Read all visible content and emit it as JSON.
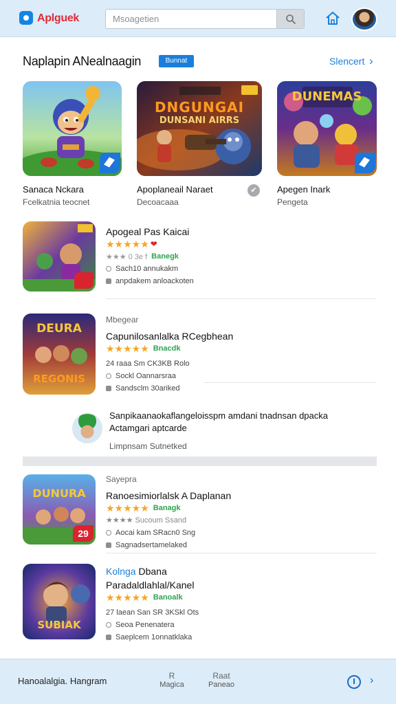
{
  "header": {
    "brand": "Aplguek",
    "search_placeholder": "Msoagetien"
  },
  "featured": {
    "title": "Naplapin ANealnaagin",
    "badge": "Bunnat",
    "see_all": "Slencert",
    "cards": [
      {
        "name": "Sanaca Nckara",
        "sub": "Fcelkatnia teocnet",
        "thumb_text": ""
      },
      {
        "name": "Apoplaneail Naraet",
        "sub": "Decoacaaa",
        "thumb_text": "DNGUNGAI",
        "thumb_text2": "DUNSANI AIRRS"
      },
      {
        "name": "Apegen Inark",
        "sub": "Pengeta",
        "thumb_text": "DUNEMAS"
      }
    ]
  },
  "list": [
    {
      "kicker": "",
      "title": "Apogeal Pas Kaicai",
      "stars": "★★★★★",
      "rating_line": "★★★ 0 3e f  Banegk",
      "line1": "Sach10 annukakm",
      "line2": "anpdakem anloackoten",
      "pill": ""
    },
    {
      "kicker": "Mbegear",
      "title": "Capunilosanlalka RCegbhean",
      "stars": "★★★★★",
      "pill": "Bnacdk",
      "meta": "24 raaa Sm CK3KB Rolo",
      "line1": "Sockl Oannarsraa",
      "line2": "Sandsclm 30ariked",
      "thumb_text": "DEURA",
      "thumb_text2": "REGONIS"
    },
    {
      "kicker": "Sayepra",
      "title": "Ranoesimiorlalsk A Daplanan",
      "stars": "★★★★★",
      "pill": "Banagk",
      "meta": "★★★★ Sucoum Ssand",
      "line1": "Aocai kam  SRacn0 Sng",
      "line2": "Sagnadsertamelaked",
      "thumb_text": "DUNURA",
      "rating_tag": "29"
    },
    {
      "kicker": "Kolnga",
      "title": "Dbana",
      "title2": "Paradaldlahlal/Kanel",
      "stars": "★★★★★",
      "pill": "Banoalk",
      "meta": "27 laean San SR 3KSkl Ots",
      "line1": "Seoa Penenatera",
      "line2": "Saeplcem 1onnatklaka",
      "thumb_text": "SUBIAK"
    }
  ],
  "promo": {
    "text": "Sanpikaanaokaflangeloisspm amdani tnadnsan dpacka Actamgari aptcarde",
    "sub": "Limpnsam Sutnetked"
  },
  "footer": {
    "left_text": "Hanoalalgia. Hangram",
    "tab1": "Magica",
    "tab2_top": "Raat",
    "tab2": "Paneao"
  }
}
